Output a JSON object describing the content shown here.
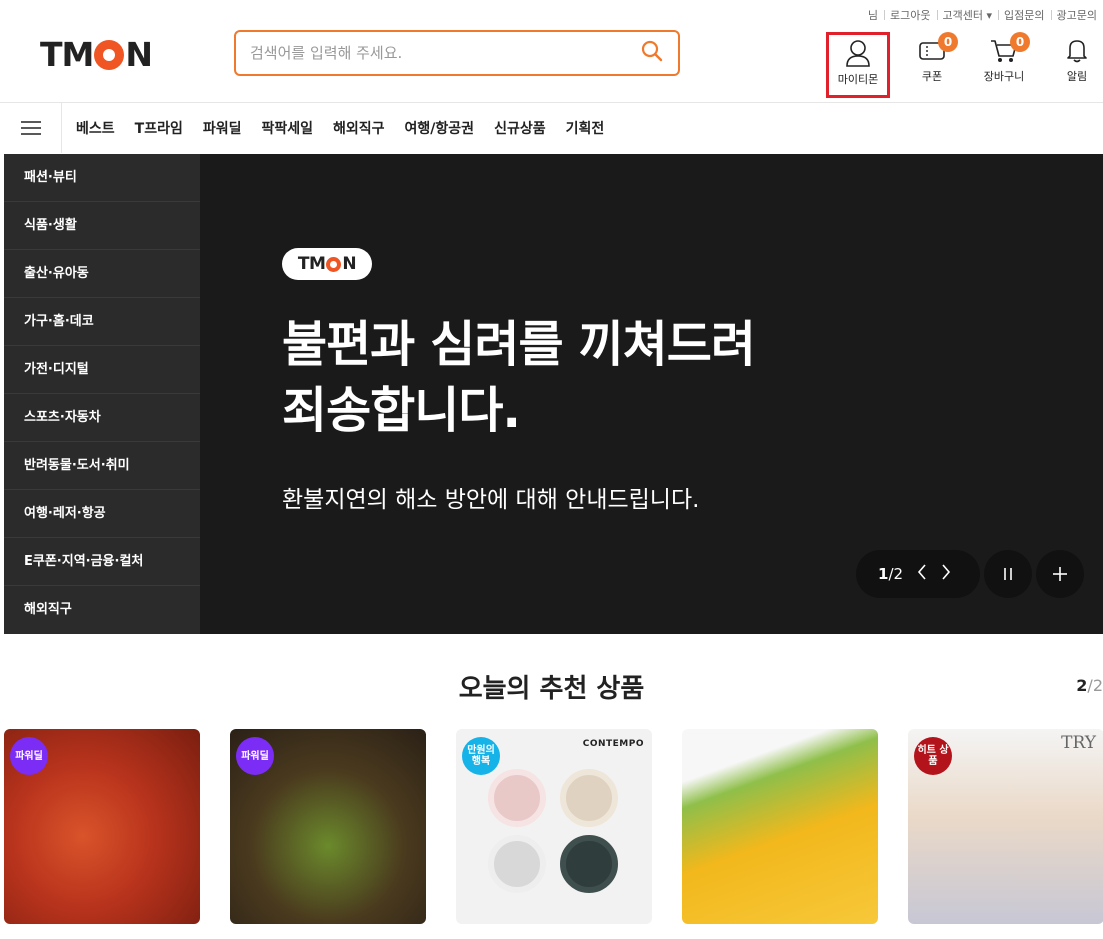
{
  "util_links": [
    "님",
    "로그아웃",
    "고객센터 ▾",
    "입점문의",
    "광고문의"
  ],
  "brand": {
    "logo_text_left": "TM",
    "logo_text_right": "N",
    "accent": "#ef5623"
  },
  "search": {
    "placeholder": "검색어를 입력해 주세요."
  },
  "header_icons": {
    "mytmon": "마이티몬",
    "coupon": "쿠폰",
    "coupon_count": "0",
    "cart": "장바구니",
    "cart_count": "0",
    "alarm": "알림"
  },
  "nav": [
    "베스트",
    "T프라임",
    "파워딜",
    "팍팍세일",
    "해외직구",
    "여행/항공권",
    "신규상품",
    "기획전"
  ],
  "categories": [
    "패션·뷰티",
    "식품·생활",
    "출산·유아동",
    "가구·홈·데코",
    "가전·디지털",
    "스포츠·자동차",
    "반려동물·도서·취미",
    "여행·레저·항공",
    "E쿠폰·지역·금융·컬처",
    "해외직구"
  ],
  "hero": {
    "logo_left": "TM",
    "logo_right": "N",
    "title_line1": "불편과 심려를 끼쳐드려",
    "title_line2": "죄송합니다.",
    "subtitle": "환불지연의 해소 방안에 대해 안내드립니다.",
    "page_current": "1",
    "page_total": "/2"
  },
  "recommended": {
    "title": "오늘의 추천 상품",
    "page_current": "2",
    "page_total": "/2",
    "cards": [
      {
        "tag": "파워딜",
        "tag_color": "#7b2cf5"
      },
      {
        "tag": "파워딜",
        "tag_color": "#7b2cf5"
      },
      {
        "tag": "만원의 행복",
        "tag_color": "#16b3e8",
        "brand": "CONTEMPO"
      },
      {
        "tag": ""
      },
      {
        "tag": "히트 상품",
        "tag_color": "#b3141b",
        "brand": "TRY"
      }
    ]
  }
}
